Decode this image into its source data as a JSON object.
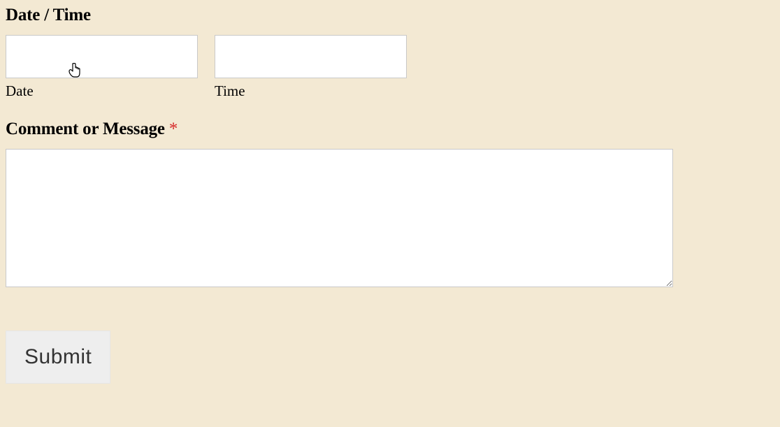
{
  "date_time": {
    "title": "Date / Time",
    "date": {
      "label": "Date",
      "value": ""
    },
    "time": {
      "label": "Time",
      "value": ""
    }
  },
  "comment": {
    "title": "Comment or Message ",
    "required_mark": "*",
    "value": ""
  },
  "submit": {
    "label": "Submit"
  }
}
